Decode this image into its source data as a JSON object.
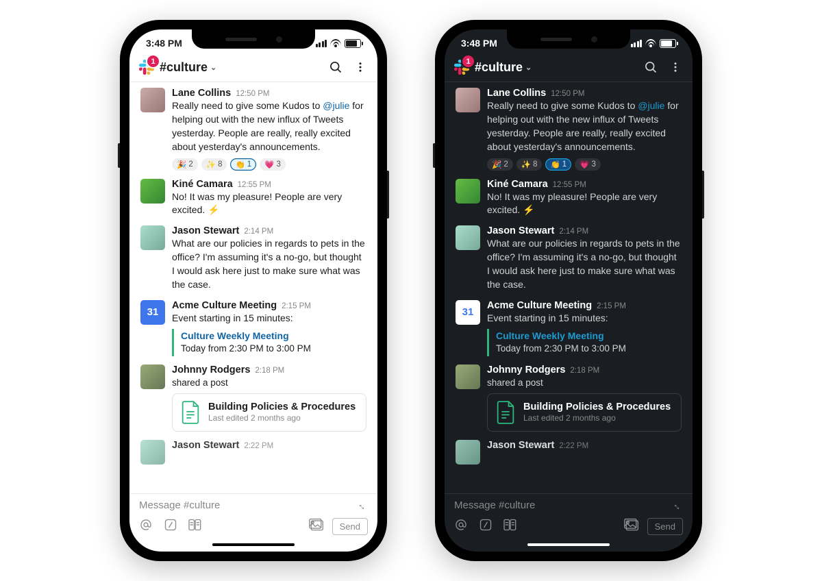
{
  "status": {
    "time": "3:48 PM"
  },
  "header": {
    "channel": "#culture",
    "badge": "1"
  },
  "messages": [
    {
      "name": "Lane Collins",
      "time": "12:50 PM",
      "text_pre": "Really need to give some Kudos to ",
      "mention": "@julie",
      "text_post": " for helping out with the new influx of Tweets yesterday. People are really, really excited about yesterday's announcements.",
      "reactions": [
        {
          "e": "🎉",
          "c": "2"
        },
        {
          "e": "✨",
          "c": "8"
        },
        {
          "e": "👏",
          "c": "1",
          "sel": true
        },
        {
          "e": "💗",
          "c": "3"
        }
      ]
    },
    {
      "name": "Kiné Camara",
      "time": "12:55 PM",
      "text": "No! It was my pleasure! People are very excited.  ⚡"
    },
    {
      "name": "Jason Stewart",
      "time": "2:14 PM",
      "text": "What are our policies in regards to pets in the office? I'm assuming it's a no-go, but thought I would ask here just to make sure what was the case."
    },
    {
      "name": "Acme Culture Meeting",
      "time": "2:15 PM",
      "text": "Event starting in 15 minutes:",
      "event_title": "Culture Weekly Meeting",
      "event_detail": "Today from 2:30 PM to 3:00 PM",
      "cal_day": "31"
    },
    {
      "name": "Johnny Rodgers",
      "time": "2:18 PM",
      "sub": "shared a post",
      "card_title": "Building Policies & Procedures",
      "card_sub": "Last edited 2 months ago"
    },
    {
      "name": "Jason Stewart",
      "time": "2:22 PM"
    }
  ],
  "composer": {
    "placeholder": "Message #culture",
    "send": "Send"
  }
}
